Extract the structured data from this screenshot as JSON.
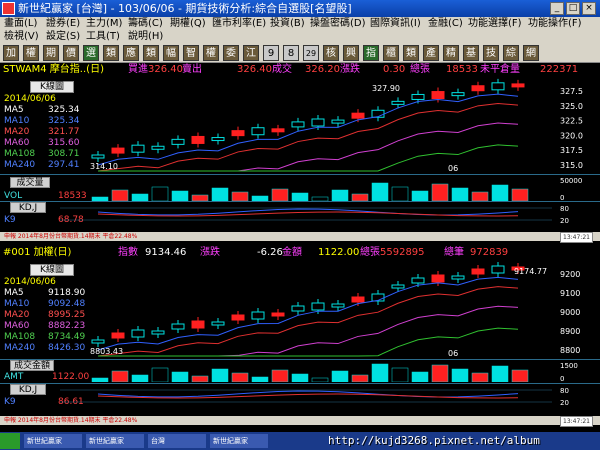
{
  "window": {
    "title": "新世紀贏家 [台灣] - 103/06/06 - 期貨技術分析:綜合自選股[名望股]"
  },
  "menu": [
    "畫面(L)",
    "證券(E)",
    "主力(M)",
    "籌碼(C)",
    "期權(Q)",
    "匯市利率(E)",
    "投資(B)",
    "操盤密碼(D)",
    "國際資訊(I)",
    "金融(C)",
    "功能選擇(F)",
    "功能操作(F)",
    "檢視(V)",
    "設定(S)",
    "工具(T)",
    "說明(H)"
  ],
  "toolbar": [
    "加",
    "權",
    "期",
    "價",
    "選",
    "類",
    "應",
    "類",
    "幅",
    "智",
    "權",
    "委",
    "江",
    "9",
    "8",
    "29",
    "核",
    "興",
    "指",
    "櫃",
    "類",
    "產",
    "精",
    "基",
    "技",
    "綜",
    "網"
  ],
  "panels": [
    {
      "symbol": "STWAM4 摩台指..(日)",
      "quote": [
        {
          "label": "買進",
          "value": "326.40"
        },
        {
          "label": "賣出",
          "value": "326.40"
        },
        {
          "label": "成交",
          "value": "326.20"
        },
        {
          "label": "漲跌",
          "value": "0.30"
        },
        {
          "label": "總張",
          "value": "18533"
        },
        {
          "label": "未平倉量",
          "value": "222371"
        }
      ],
      "chart_tag": "K線圖",
      "date": "2014/06/06",
      "indicators": [
        {
          "name": "MA5",
          "value": "325.34"
        },
        {
          "name": "MA10",
          "value": "325.34"
        },
        {
          "name": "MA20",
          "value": "321.77"
        },
        {
          "name": "MA60",
          "value": "315.60"
        },
        {
          "name": "MA108",
          "value": "308.71"
        },
        {
          "name": "MA240",
          "value": "297.41"
        }
      ],
      "low_label": "314.10",
      "high_label": "327.90",
      "month_label": "06",
      "price_axis": [
        "327.5",
        "325.0",
        "322.5",
        "320.0",
        "317.5",
        "315.0"
      ],
      "volume_tag": "成交量",
      "vol_label": "VOL",
      "vol_value": "18533",
      "vol_axis": [
        "50000",
        "0"
      ],
      "kd_tag": "KD,J",
      "k_label": "K9",
      "k_value": "68.78",
      "kd_axis": [
        "80",
        "20"
      ],
      "status_text": "申報 2014年8月份台幣期貨.14期末 平倉22.48%",
      "status_time": "13:47:21"
    },
    {
      "symbol": "#001 加權(日)",
      "quote": [
        {
          "label": "指數",
          "value": "9134.46"
        },
        {
          "label": "漲跌",
          "value": "-6.26"
        },
        {
          "label": "金額",
          "value": "1122.00"
        },
        {
          "label": "總張",
          "value": "5592895"
        },
        {
          "label": "總筆",
          "value": "972839"
        }
      ],
      "chart_tag": "K線圖",
      "date": "2014/06/06",
      "indicators": [
        {
          "name": "MA5",
          "value": "9118.90"
        },
        {
          "name": "MA10",
          "value": "9092.48"
        },
        {
          "name": "MA20",
          "value": "8995.25"
        },
        {
          "name": "MA60",
          "value": "8882.23"
        },
        {
          "name": "MA108",
          "value": "8734.49"
        },
        {
          "name": "MA240",
          "value": "8426.30"
        }
      ],
      "low_label": "8803.43",
      "high_label": "9174.77",
      "month_label": "06",
      "price_axis": [
        "9200",
        "9100",
        "9000",
        "8900",
        "8800"
      ],
      "volume_tag": "成交金額",
      "vol_label": "AMT",
      "vol_value": "1122.00",
      "vol_axis": [
        "1500",
        "0"
      ],
      "kd_tag": "KD,J",
      "k_label": "K9",
      "k_value": "86.61",
      "kd_axis": [
        "80",
        "20"
      ],
      "status_text": "申報 2014年8月份台幣期貨.14期末 平倉22.48%",
      "status_time": "13:47:21"
    }
  ],
  "taskbar": [
    "開始",
    "新世紀贏家",
    "新世紀贏家",
    "台灣",
    "新世紀贏家"
  ],
  "watermark": "http://kujd3268.pixnet.net/album",
  "colors": {
    "up": "#ff2020",
    "down": "#00e0e0",
    "ma5": "#ffffff",
    "ma10": "#3060ff",
    "ma20": "#e03030",
    "ma60": "#d040d0",
    "ma108": "#30c030",
    "ma240": "#2050d0"
  }
}
